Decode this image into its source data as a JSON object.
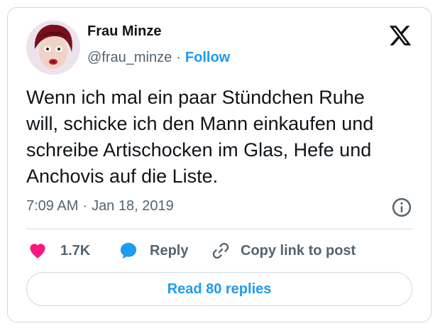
{
  "author": {
    "name": "Frau Minze",
    "handle": "@frau_minze",
    "separator": "·",
    "follow_label": "Follow"
  },
  "tweet": {
    "lines": [
      "Wenn ich mal ein paar Stündchen Ruhe",
      "will, schicke ich den Mann einkaufen und",
      "schreibe Artischocken im Glas, Hefe und",
      "Anchovis auf die Liste."
    ],
    "time": "7:09 AM",
    "date": "Jan 18, 2019",
    "separator": "·"
  },
  "actions": {
    "likes": "1.7K",
    "reply_label": "Reply",
    "copy_label": "Copy link to post"
  },
  "footer": {
    "read_replies_label": "Read 80 replies"
  },
  "icons": {
    "brand": "x-logo-icon",
    "info": "info-icon",
    "like": "heart-icon",
    "reply": "speech-bubble-icon",
    "copy": "link-icon"
  },
  "colors": {
    "accent": "#1d9bf0",
    "like": "#f91880",
    "text": "#0f1419",
    "muted": "#536471",
    "border": "#cfd9de"
  }
}
